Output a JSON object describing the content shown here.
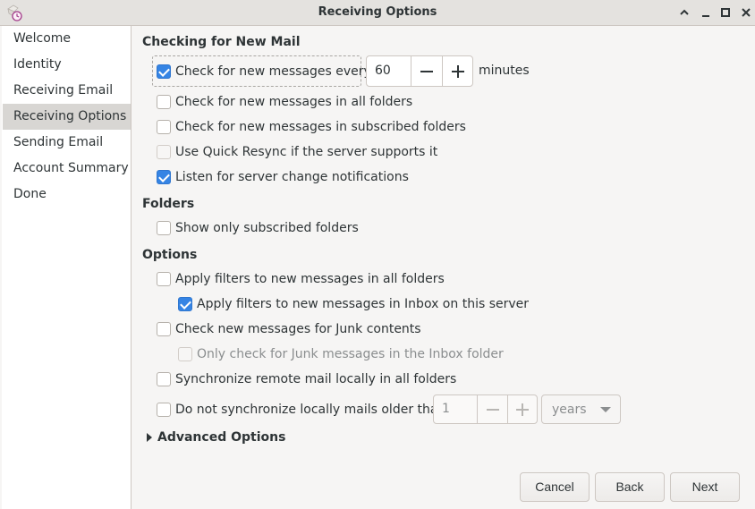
{
  "window": {
    "title": "Receiving Options",
    "controls": [
      "chevron-up-icon",
      "minimize-icon",
      "maximize-icon",
      "close-icon"
    ]
  },
  "sidebar": {
    "items": [
      {
        "label": "Welcome"
      },
      {
        "label": "Identity"
      },
      {
        "label": "Receiving Email"
      },
      {
        "label": "Receiving Options",
        "active": true
      },
      {
        "label": "Sending Email"
      },
      {
        "label": "Account Summary"
      },
      {
        "label": "Done"
      }
    ]
  },
  "checking": {
    "title": "Checking for New Mail",
    "check_every": {
      "label": "Check for new messages every",
      "checked": true
    },
    "interval_value": "60",
    "interval_unit": "minutes",
    "all_folders": {
      "label": "Check for new messages in all folders",
      "checked": false
    },
    "subscribed_folders": {
      "label": "Check for new messages in subscribed folders",
      "checked": false
    },
    "quick_resync": {
      "label": "Use Quick Resync if the server supports it",
      "checked": false,
      "disabled": true
    },
    "listen_changes": {
      "label": "Listen for server change notifications",
      "checked": true
    }
  },
  "folders": {
    "title": "Folders",
    "only_subscribed": {
      "label": "Show only subscribed folders",
      "checked": false
    }
  },
  "options": {
    "title": "Options",
    "filters_all": {
      "label": "Apply filters to new messages in all folders",
      "checked": false
    },
    "filters_inbox": {
      "label": "Apply filters to new messages in Inbox on this server",
      "checked": true
    },
    "junk": {
      "label": "Check new messages for Junk contents",
      "checked": false
    },
    "junk_inbox_only": {
      "label": "Only check for Junk messages in the Inbox folder",
      "checked": false,
      "disabled": true
    },
    "sync_all": {
      "label": "Synchronize remote mail locally in all folders",
      "checked": false
    },
    "no_sync_older": {
      "label": "Do not synchronize locally mails older than",
      "checked": false
    },
    "older_value": "1",
    "older_unit": "years"
  },
  "advanced": {
    "label": "Advanced Options",
    "expanded": false
  },
  "buttons": {
    "cancel": "Cancel",
    "back": "Back",
    "next": "Next"
  },
  "colors": {
    "accent": "#3584e4",
    "sidebar_selected": "#d8d6d3",
    "window_bg": "#f6f5f4"
  }
}
